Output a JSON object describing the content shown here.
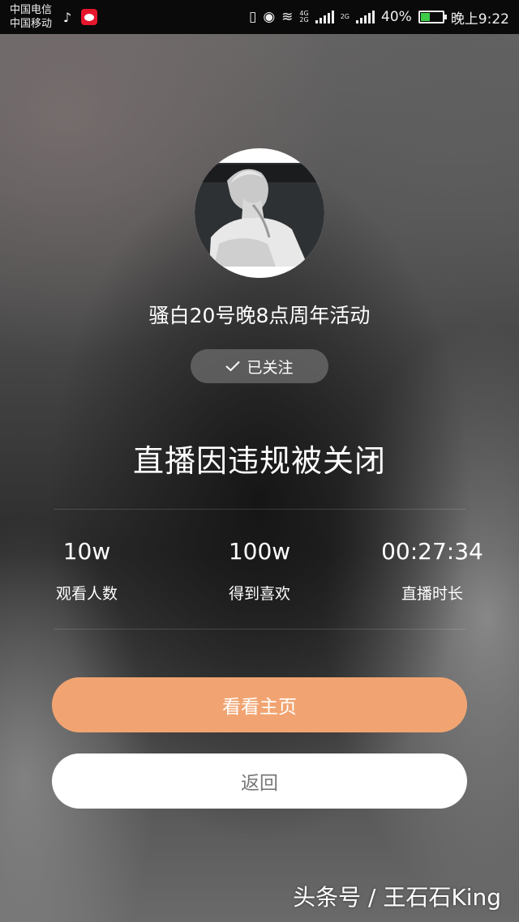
{
  "status_bar": {
    "carrier_1": "中国电信",
    "carrier_2": "中国移动",
    "net_1": "4G",
    "net_2": "2G",
    "net_3": "2G",
    "battery_percent": "40%",
    "time": "晚上9:22",
    "icons": [
      "tiktok-icon",
      "weibo-icon",
      "vibrate-icon",
      "eye-icon",
      "wifi-icon",
      "signal-icon",
      "battery-icon"
    ]
  },
  "profile": {
    "title": "骚白20号晚8点周年活动",
    "follow_label": "已关注"
  },
  "notice": {
    "headline": "直播因违规被关闭"
  },
  "stats": [
    {
      "value": "10w",
      "label": "观看人数"
    },
    {
      "value": "100w",
      "label": "得到喜欢"
    },
    {
      "value": "00:27:34",
      "label": "直播时长"
    }
  ],
  "actions": {
    "home_label": "看看主页",
    "back_label": "返回"
  },
  "watermark": "头条号 / 王石石King",
  "colors": {
    "primary_button": "#f1a471",
    "secondary_button": "#ffffff",
    "battery_fill": "#3ecb4a"
  }
}
